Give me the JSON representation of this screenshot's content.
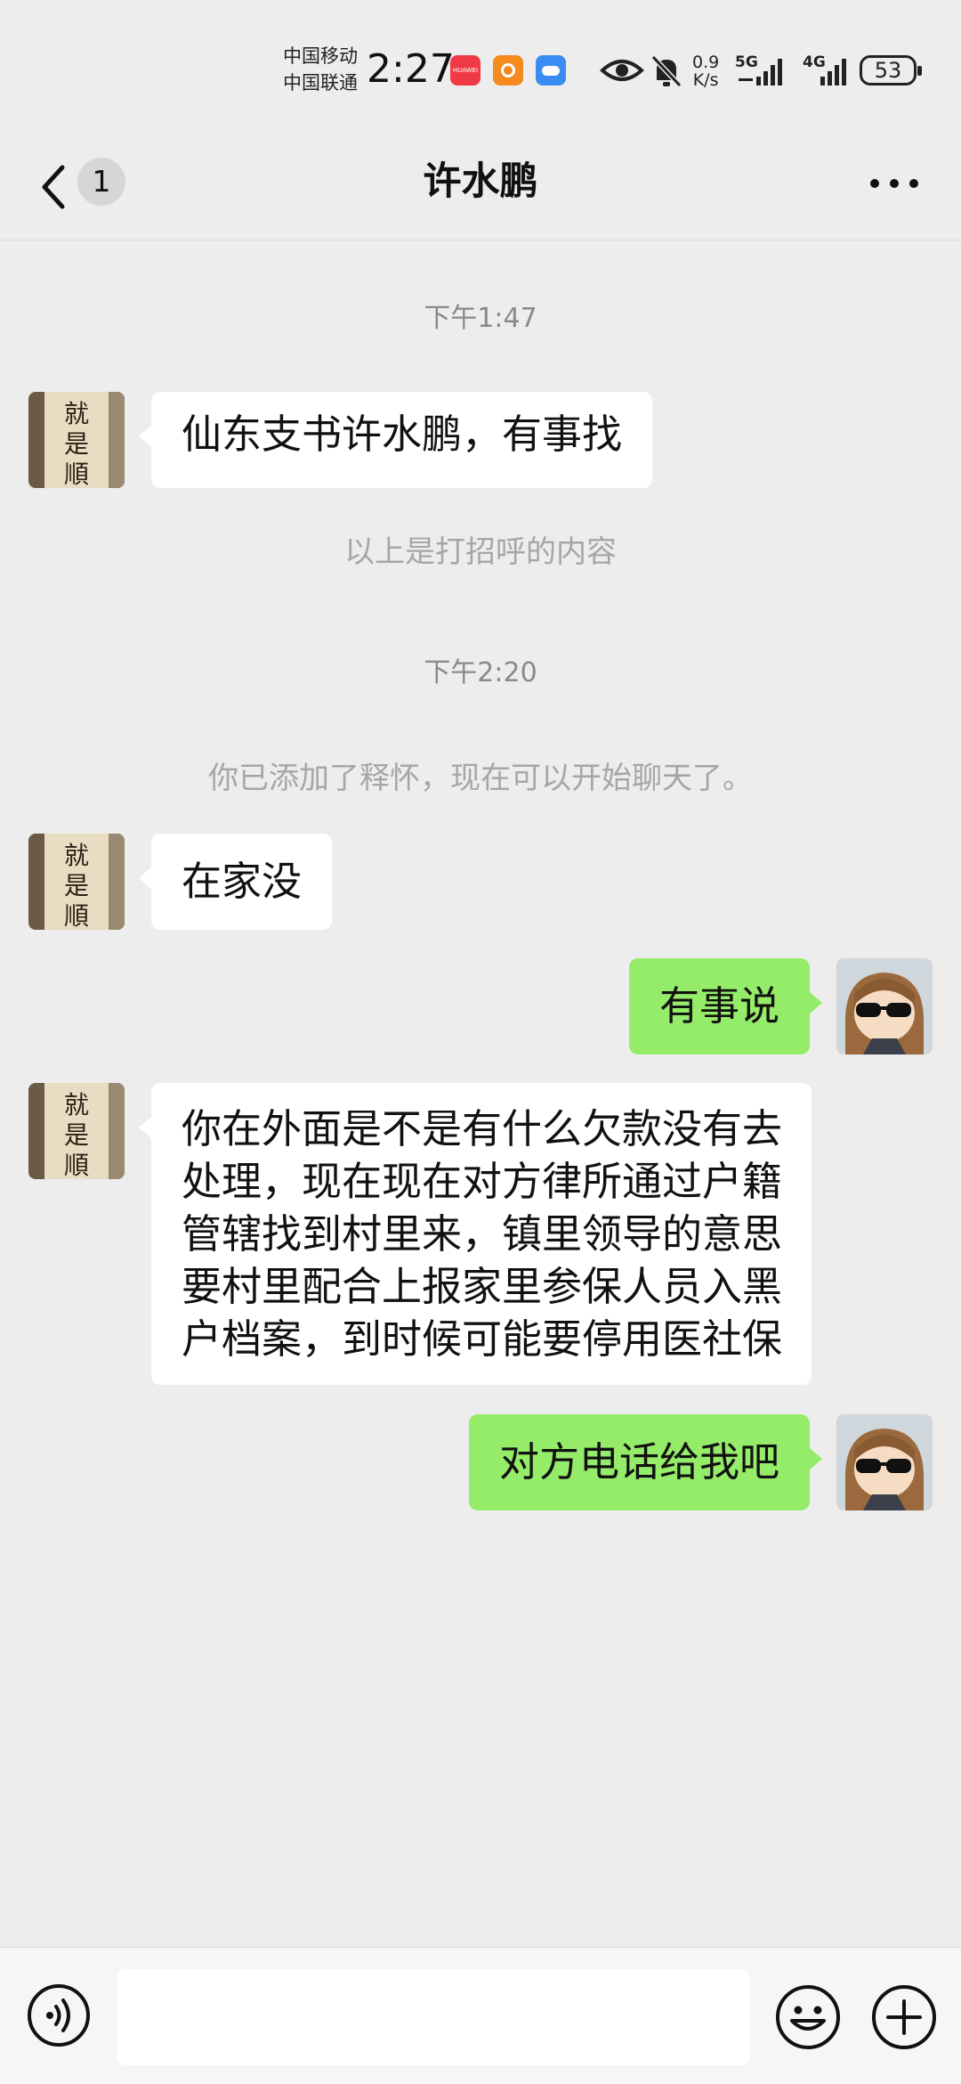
{
  "status_bar": {
    "carrier_1": "中国移动",
    "carrier_2": "中国联通",
    "time": "2:27",
    "huawei_label": "HUAWEI",
    "net_speed_value": "0.9",
    "net_speed_unit": "K/s",
    "network_1": "5G",
    "network_2": "4G",
    "battery": "53"
  },
  "header": {
    "unread_count": "1",
    "title": "许水鹏"
  },
  "contact": {
    "avatar_text": [
      "就",
      "是",
      "順"
    ]
  },
  "messages": {
    "ts_1": "下午1:47",
    "msg_1": "仙东支书许水鹏，有事找",
    "sys_1": "以上是打招呼的内容",
    "ts_2": "下午2:20",
    "sys_2": "你已添加了释怀，现在可以开始聊天了。",
    "msg_2": "在家没",
    "msg_3": "有事说",
    "msg_4": "你在外面是不是有什么欠款没有去处理，现在现在对方律所通过户籍管辖找到村里来，镇里领导的意思要村里配合上报家里参保人员入黑户档案，到时候可能要停用医社保",
    "msg_5": "对方电话给我吧"
  },
  "input": {
    "value": "",
    "placeholder": ""
  },
  "colors": {
    "background": "#ededed",
    "bubble_self": "#95ec69",
    "bubble_other": "#ffffff"
  },
  "icons": [
    "back-arrow-icon",
    "more-icon",
    "voice-icon",
    "emoji-icon",
    "plus-icon",
    "eye-icon",
    "mute-bell-icon",
    "signal-icon"
  ]
}
